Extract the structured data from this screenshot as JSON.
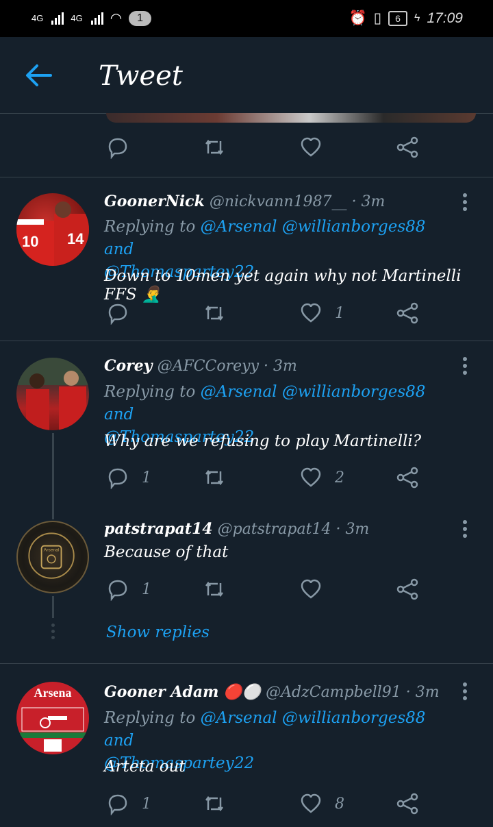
{
  "status": {
    "left_net1": "4G",
    "left_net2": "4G",
    "notif_count": "1",
    "battery": "6",
    "time": "17:09"
  },
  "header": {
    "title": "Tweet"
  },
  "tweets": [
    {
      "name": "GoonerNick",
      "handle": "@nickvann1987__",
      "time": "· 3m",
      "reply_prefix": "Replying to",
      "mentions": "@Arsenal @willianborges88",
      "and": "and",
      "mention2": "@Thomasparteу22",
      "text": "Down to 10men yet again why not Martinelli FFS 🤦‍♂️",
      "reply_count": "",
      "like_count": "1"
    },
    {
      "name": "Corey",
      "handle": "@AFCCoreyy",
      "time": "· 3m",
      "reply_prefix": "Replying to",
      "mentions": "@Arsenal @willianborges88",
      "and": "and",
      "mention2": "@Thomasparteу22",
      "text": "Why are we refusing to play Martinelli?",
      "reply_count": "1",
      "like_count": "2"
    },
    {
      "name": "patstrapat14",
      "handle": "@patstrapat14",
      "time": "· 3m",
      "text": "Because of that",
      "reply_count": "1",
      "like_count": ""
    },
    {
      "name": "Gooner Adam",
      "emoji": "🔴⚪",
      "handle": "@AdzCampbell91",
      "time": "· 3m",
      "reply_prefix": "Replying to",
      "mentions": "@Arsenal @willianborges88",
      "and": "and",
      "mention2": "@Thomasparteу22",
      "text": "Arteta out",
      "reply_count": "1",
      "like_count": "8"
    }
  ],
  "show_replies": "Show replies",
  "colors": {
    "background": "#15202b",
    "accent": "#1da1f2",
    "muted": "#8899a6",
    "divider": "#38444d"
  }
}
